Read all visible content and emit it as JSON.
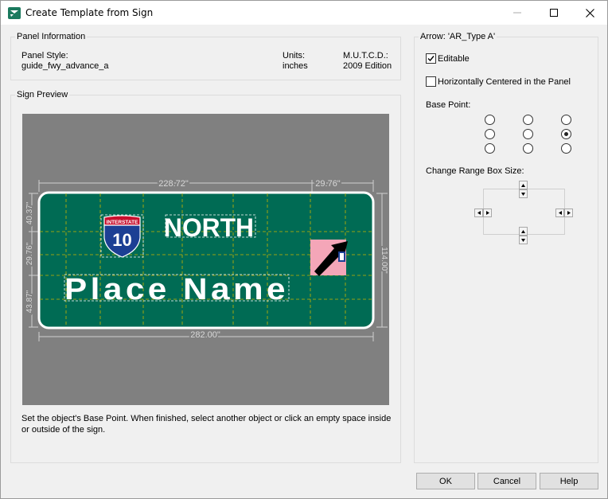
{
  "window": {
    "title": "Create Template from Sign"
  },
  "panel_info": {
    "group_label": "Panel Information",
    "panel_style_label": "Panel Style:",
    "panel_style_value": "guide_fwy_advance_a",
    "units_label": "Units:",
    "units_value": "inches",
    "mutcd_label": "M.U.T.C.D.:",
    "mutcd_value": "2009 Edition"
  },
  "sign_preview": {
    "group_label": "Sign Preview",
    "dim_top_main": "228.72\"",
    "dim_top_right": "29.76\"",
    "dim_bottom": "282.00\"",
    "dim_left_1": "40.37\"",
    "dim_left_2": "29.76\"",
    "dim_left_3": "43.87\"",
    "dim_right": "114.00\"",
    "shield_banner": "INTERSTATE",
    "shield_number": "10",
    "direction_text": "NORTH",
    "destination_text": "Place Name",
    "colors": {
      "sign_green": "#006b54",
      "background": "#808080",
      "arrow_highlight": "#f4a6b8",
      "shield_blue": "#1c3f94",
      "shield_red": "#c8102e"
    }
  },
  "instructions": "Set the object's Base Point. When finished, select another object or click an empty space inside or outside of the sign.",
  "arrow_panel": {
    "group_label": "Arrow: 'AR_Type A'",
    "editable_label": "Editable",
    "editable_checked": true,
    "hcenter_label": "Horizontally Centered in the Panel",
    "hcenter_checked": false,
    "base_point_label": "Base Point:",
    "base_point_selected": "middle-right",
    "range_box_label": "Change Range Box Size:"
  },
  "buttons": {
    "ok": "OK",
    "cancel": "Cancel",
    "help": "Help"
  }
}
